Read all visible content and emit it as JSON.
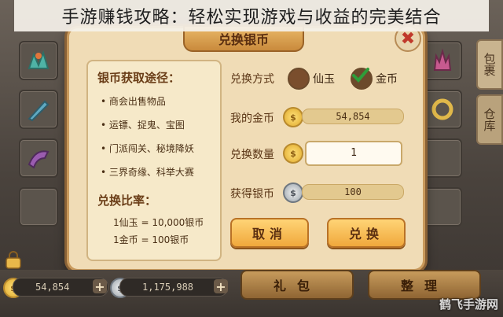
{
  "page_title": "手游赚钱攻略：轻松实现游戏与收益的完美结合",
  "dialog": {
    "title": "兑换银币",
    "close_glyph": "✖",
    "info": {
      "heading1": "银币获取途径：",
      "ways": [
        "商会出售物品",
        "运镖、捉鬼、宝图",
        "门派闯关、秘境降妖",
        "三界奇缘、科举大赛"
      ],
      "heading2": "兑换比率：",
      "rates": [
        "1仙玉 = 10,000银币",
        "1金币 = 100银币"
      ]
    },
    "method_label": "兑换方式",
    "option_jade": "仙玉",
    "option_gold": "金币",
    "selected_option": "金币",
    "my_gold_label": "我的金币",
    "my_gold_value": "54,854",
    "qty_label": "兑换数量",
    "qty_value": "1",
    "get_silver_label": "获得银币",
    "get_silver_value": "100",
    "cancel_label": "取消",
    "confirm_label": "兑换"
  },
  "side_tabs": {
    "bag": "包裹",
    "warehouse": "仓库"
  },
  "bottom": {
    "gold_amount": "54,854",
    "silver_amount": "1,175,988",
    "gift_label": "礼包",
    "sort_label": "整理"
  },
  "watermark": "鹤飞手游网",
  "colors": {
    "accent": "#f0a83c",
    "panel": "#f0dcb6",
    "check": "#2e9e3a"
  }
}
